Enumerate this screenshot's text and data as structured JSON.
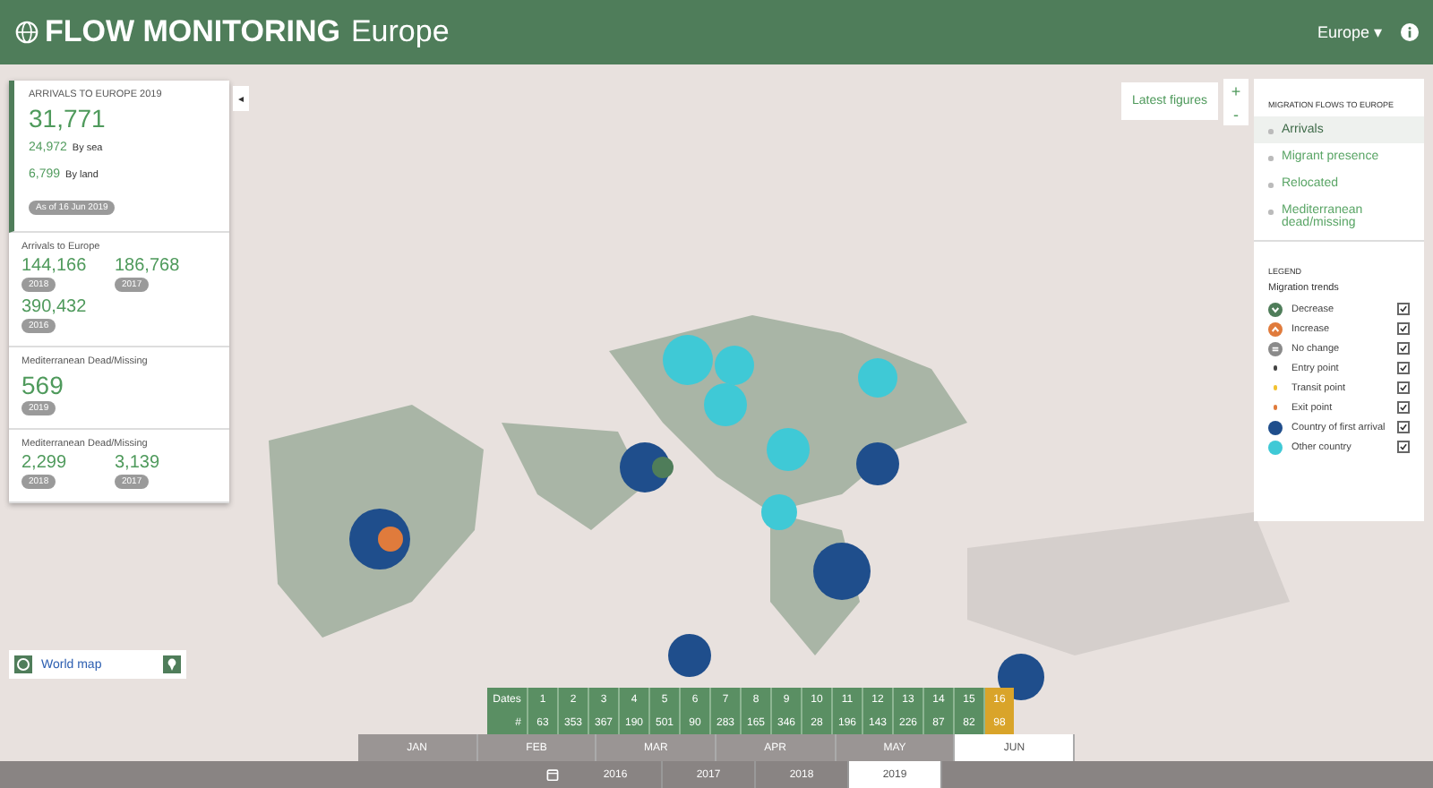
{
  "header": {
    "brand": "FLOW MONITORING",
    "region_title": "Europe",
    "region_menu": "Europe",
    "caret": "▾"
  },
  "summary": {
    "heading": "ARRIVALS TO EUROPE 2019",
    "total": "31,771",
    "breakdown": [
      {
        "value": "24,972",
        "label": "By sea"
      },
      {
        "value": "6,799",
        "label": "By land"
      }
    ],
    "badge": "As of 16 Jun 2019"
  },
  "cards": [
    {
      "heading": "Arrivals to Europe",
      "figures": [
        {
          "value": "144,166",
          "year": "2018"
        },
        {
          "value": "186,768",
          "year": "2017"
        },
        {
          "value": "390,432",
          "year": "2016"
        }
      ]
    },
    {
      "heading": "Mediterranean Dead/Missing",
      "figures": [
        {
          "value": "569",
          "year": "2019"
        }
      ]
    },
    {
      "heading": "Mediterranean Dead/Missing",
      "figures": [
        {
          "value": "2,299",
          "year": "2018"
        },
        {
          "value": "3,139",
          "year": "2017"
        }
      ]
    }
  ],
  "collapse": "◂",
  "world_map_button": "World map",
  "latest_figures": "Latest figures",
  "zoom": {
    "in": "+",
    "out": "-"
  },
  "flows": {
    "heading": "MIGRATION FLOWS TO EUROPE",
    "items": [
      {
        "label": "Arrivals",
        "selected": true
      },
      {
        "label": "Migrant presence",
        "selected": false
      },
      {
        "label": "Relocated",
        "selected": false
      },
      {
        "label": "Mediterranean dead/missing",
        "selected": false
      }
    ]
  },
  "legend": {
    "heading": "LEGEND",
    "subheading": "Migration trends",
    "items": [
      {
        "kind": "down",
        "label": "Decrease",
        "color": "#4f7d5a",
        "checked": true
      },
      {
        "kind": "up",
        "label": "Increase",
        "color": "#e07b3c",
        "checked": true
      },
      {
        "kind": "flat",
        "label": "No change",
        "color": "#8a8a8a",
        "checked": true
      },
      {
        "kind": "dot",
        "label": "Entry point",
        "color": "#444444",
        "checked": true
      },
      {
        "kind": "dot",
        "label": "Transit point",
        "color": "#f2c230",
        "checked": true
      },
      {
        "kind": "dot",
        "label": "Exit point",
        "color": "#e07b3c",
        "checked": true
      },
      {
        "kind": "disc",
        "label": "Country of first arrival",
        "color": "#1f4e8c",
        "checked": true
      },
      {
        "kind": "disc",
        "label": "Other country",
        "color": "#3fc9d6",
        "checked": true
      }
    ]
  },
  "timeline": {
    "dates_label": "Dates",
    "count_label": "#",
    "days": [
      {
        "date": "1",
        "count": "63",
        "selected": false
      },
      {
        "date": "2",
        "count": "353",
        "selected": false
      },
      {
        "date": "3",
        "count": "367",
        "selected": false
      },
      {
        "date": "4",
        "count": "190",
        "selected": false
      },
      {
        "date": "5",
        "count": "501",
        "selected": false
      },
      {
        "date": "6",
        "count": "90",
        "selected": false
      },
      {
        "date": "7",
        "count": "283",
        "selected": false
      },
      {
        "date": "8",
        "count": "165",
        "selected": false
      },
      {
        "date": "9",
        "count": "346",
        "selected": false
      },
      {
        "date": "10",
        "count": "28",
        "selected": false
      },
      {
        "date": "11",
        "count": "196",
        "selected": false
      },
      {
        "date": "12",
        "count": "143",
        "selected": false
      },
      {
        "date": "13",
        "count": "226",
        "selected": false
      },
      {
        "date": "14",
        "count": "87",
        "selected": false
      },
      {
        "date": "15",
        "count": "82",
        "selected": false
      },
      {
        "date": "16",
        "count": "98",
        "selected": true
      }
    ],
    "months": [
      {
        "label": "JAN",
        "selected": false
      },
      {
        "label": "FEB",
        "selected": false
      },
      {
        "label": "MAR",
        "selected": false
      },
      {
        "label": "APR",
        "selected": false
      },
      {
        "label": "MAY",
        "selected": false
      },
      {
        "label": "JUN",
        "selected": true
      }
    ],
    "years": [
      {
        "label": "2016",
        "selected": false
      },
      {
        "label": "2017",
        "selected": false
      },
      {
        "label": "2018",
        "selected": false
      },
      {
        "label": "2019",
        "selected": true
      }
    ]
  }
}
